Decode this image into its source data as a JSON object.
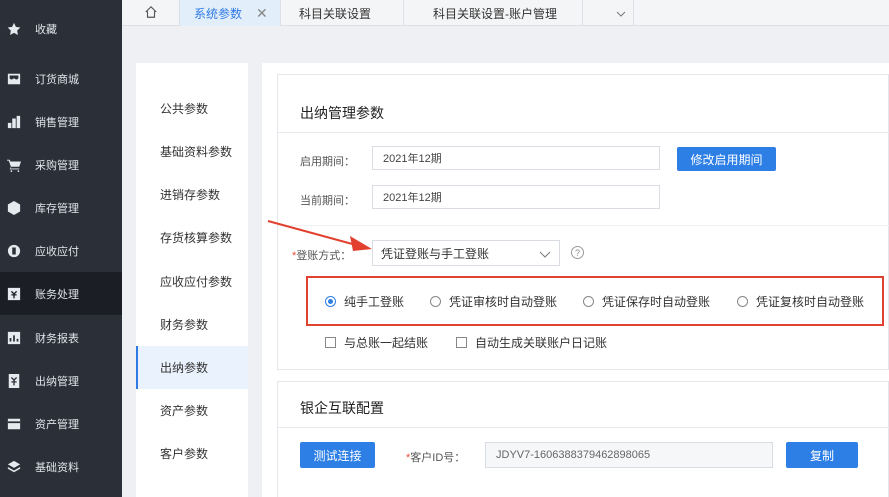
{
  "sidebar": {
    "items": [
      {
        "label": "收藏",
        "icon": "star-icon",
        "active": false
      },
      {
        "label": "订货商城",
        "icon": "store-icon",
        "active": false
      },
      {
        "label": "销售管理",
        "icon": "bar-chart-icon",
        "active": false
      },
      {
        "label": "采购管理",
        "icon": "cart-icon",
        "active": false
      },
      {
        "label": "库存管理",
        "icon": "box-icon",
        "active": false
      },
      {
        "label": "应收应付",
        "icon": "coin-icon",
        "active": false
      },
      {
        "label": "账务处理",
        "icon": "ledger-icon",
        "active": true
      },
      {
        "label": "财务报表",
        "icon": "report-icon",
        "active": false
      },
      {
        "label": "出纳管理",
        "icon": "cashier-icon",
        "active": false
      },
      {
        "label": "资产管理",
        "icon": "asset-icon",
        "active": false
      },
      {
        "label": "基础资料",
        "icon": "layers-icon",
        "active": false
      }
    ]
  },
  "tabs": [
    {
      "label": "系统参数",
      "active": true,
      "closable": true
    },
    {
      "label": "科目关联设置",
      "active": false,
      "closable": false
    },
    {
      "label": "科目关联设置-账户管理",
      "active": false,
      "closable": false
    }
  ],
  "param_menu": {
    "items": [
      "公共参数",
      "基础资料参数",
      "进销存参数",
      "存货核算参数",
      "应收应付参数",
      "财务参数",
      "出纳参数",
      "资产参数",
      "客户参数"
    ],
    "active_index": 6
  },
  "cashier": {
    "title": "出纳管理参数",
    "start_period_label": "启用期间：",
    "start_period_value": "2021年12期",
    "modify_button": "修改启用期间",
    "current_period_label": "当前期间：",
    "current_period_value": "2021年12期",
    "posting_required": "*",
    "posting_label": "登账方式：",
    "posting_value": "凭证登账与手工登账",
    "help": "?",
    "radios": [
      {
        "label": "纯手工登账",
        "checked": true
      },
      {
        "label": "凭证审核时自动登账",
        "checked": false
      },
      {
        "label": "凭证保存时自动登账",
        "checked": false
      },
      {
        "label": "凭证复核时自动登账",
        "checked": false
      }
    ],
    "checks": [
      {
        "label": "与总账一起结账",
        "checked": false
      },
      {
        "label": "自动生成关联账户日记账",
        "checked": false
      }
    ]
  },
  "bank": {
    "title": "银企互联配置",
    "test_button": "测试连接",
    "client_required": "*",
    "client_label": "客户ID号：",
    "client_value": "JDYV7-1606388379462898065",
    "copy_button": "复制"
  },
  "colors": {
    "sidebar_bg": "#2b2f37",
    "accent": "#2d7fe6",
    "highlight_box": "#e2412f",
    "annotation_arrow": "#e2412f"
  }
}
